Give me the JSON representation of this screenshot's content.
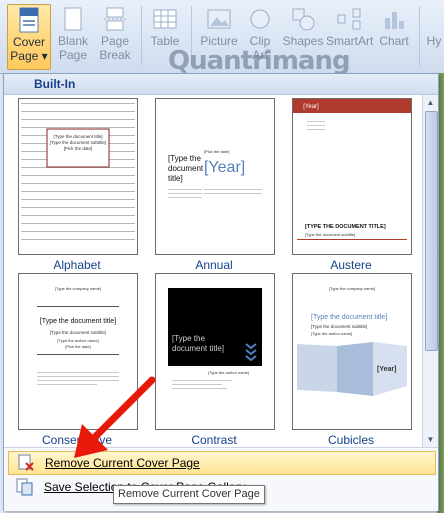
{
  "ribbon": {
    "buttons": [
      {
        "line1": "Cover",
        "line2": "Page",
        "arrow": "▾"
      },
      {
        "line1": "Blank",
        "line2": "Page"
      },
      {
        "line1": "Page",
        "line2": "Break"
      },
      {
        "line1": "Table",
        "line2": ""
      },
      {
        "line1": "Picture",
        "line2": ""
      },
      {
        "line1": "Clip",
        "line2": "Art"
      },
      {
        "line1": "Shapes",
        "line2": ""
      },
      {
        "line1": "SmartArt",
        "line2": ""
      },
      {
        "line1": "Chart",
        "line2": ""
      },
      {
        "line1": "Hy",
        "line2": ""
      }
    ],
    "watermark": "Quantrimang"
  },
  "menu": {
    "section_header": "Built-In",
    "templates": [
      {
        "caption": "Alphabet",
        "title": "[Type the document title]",
        "subtitle": "[Type the document subtitle]",
        "date": "[Pick the date]"
      },
      {
        "caption": "Annual",
        "title": "[Type the document title]",
        "year": "[Year]",
        "date": "[Pick the date]"
      },
      {
        "caption": "Austere",
        "year": "[Year]",
        "title": "[TYPE THE DOCUMENT TITLE]",
        "subtitle": "[Type the document subtitle]"
      },
      {
        "caption": "Conservative",
        "company": "[Type the company name]",
        "title": "[Type the document title]",
        "subtitle": "[Type the document subtitle]",
        "author": "[Type the author name]",
        "date": "[Pick the date]"
      },
      {
        "caption": "Contrast",
        "title": "[Type the document title]",
        "author": "[Type the author name]"
      },
      {
        "caption": "Cubicles",
        "company": "[Type the company name]",
        "title": "[Type the document title]",
        "subtitle": "[Type the document subtitle]",
        "author": "[Type the author name]",
        "year": "[Year]"
      }
    ],
    "remove_label": "Remove Current Cover Page",
    "save_label": "Save Selection to Cover Page Gallery..."
  },
  "tooltip": "Remove Current Cover Page",
  "colors": {
    "accent": "#15428b",
    "highlight": "#ffe491",
    "arrow": "#e8190b",
    "austere_red": "#b03a2e"
  }
}
